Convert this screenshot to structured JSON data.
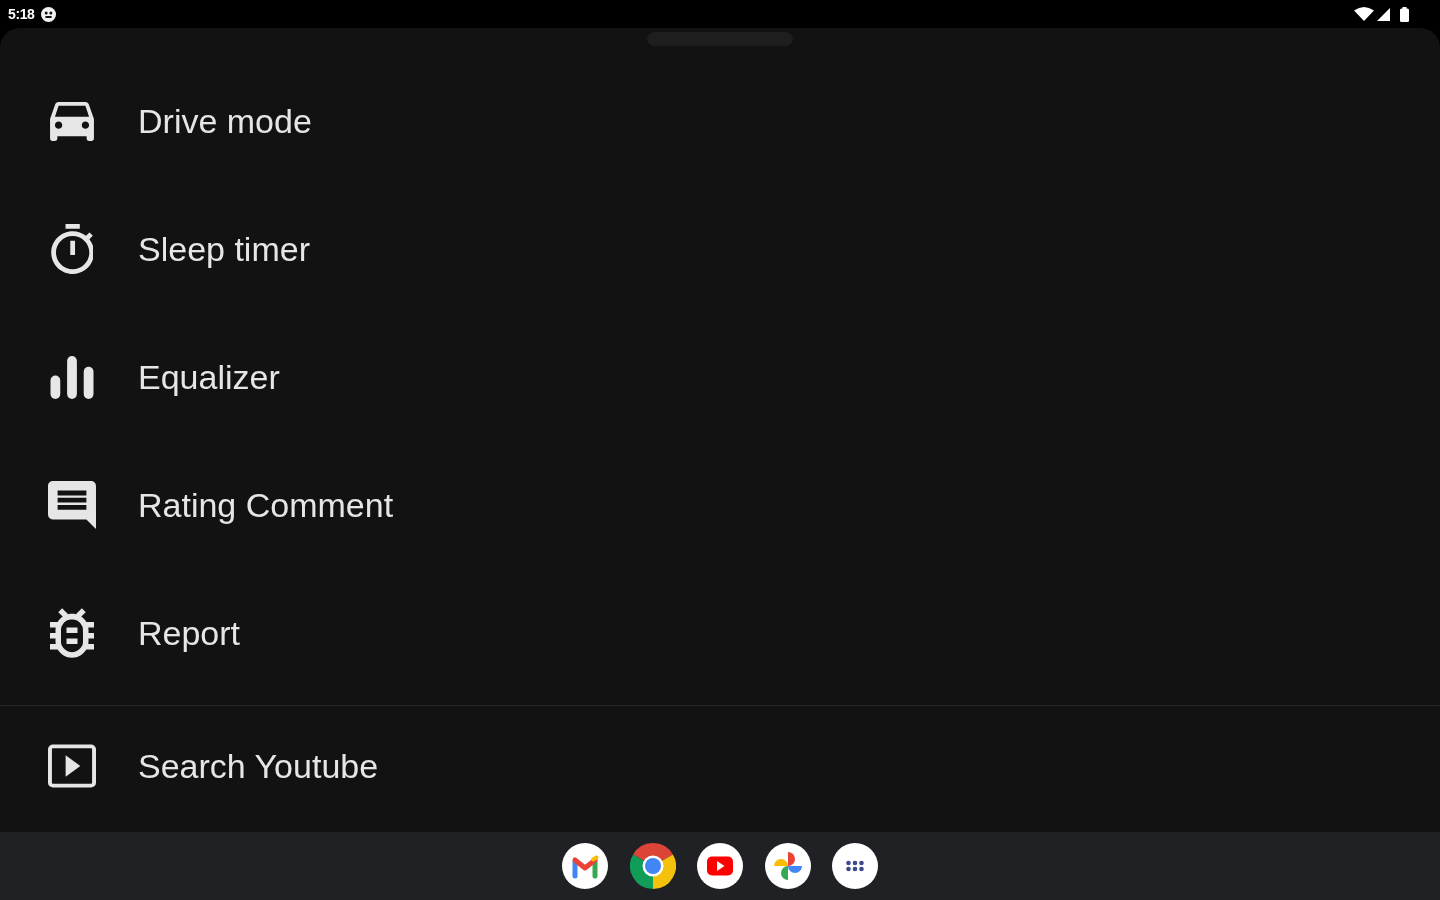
{
  "status_bar": {
    "time": "5:18"
  },
  "menu": {
    "groups": [
      {
        "items": [
          {
            "label": "Drive mode"
          },
          {
            "label": "Sleep timer"
          },
          {
            "label": "Equalizer"
          },
          {
            "label": "Rating Comment"
          },
          {
            "label": "Report"
          }
        ]
      },
      {
        "items": [
          {
            "label": "Search Youtube"
          }
        ]
      }
    ]
  }
}
